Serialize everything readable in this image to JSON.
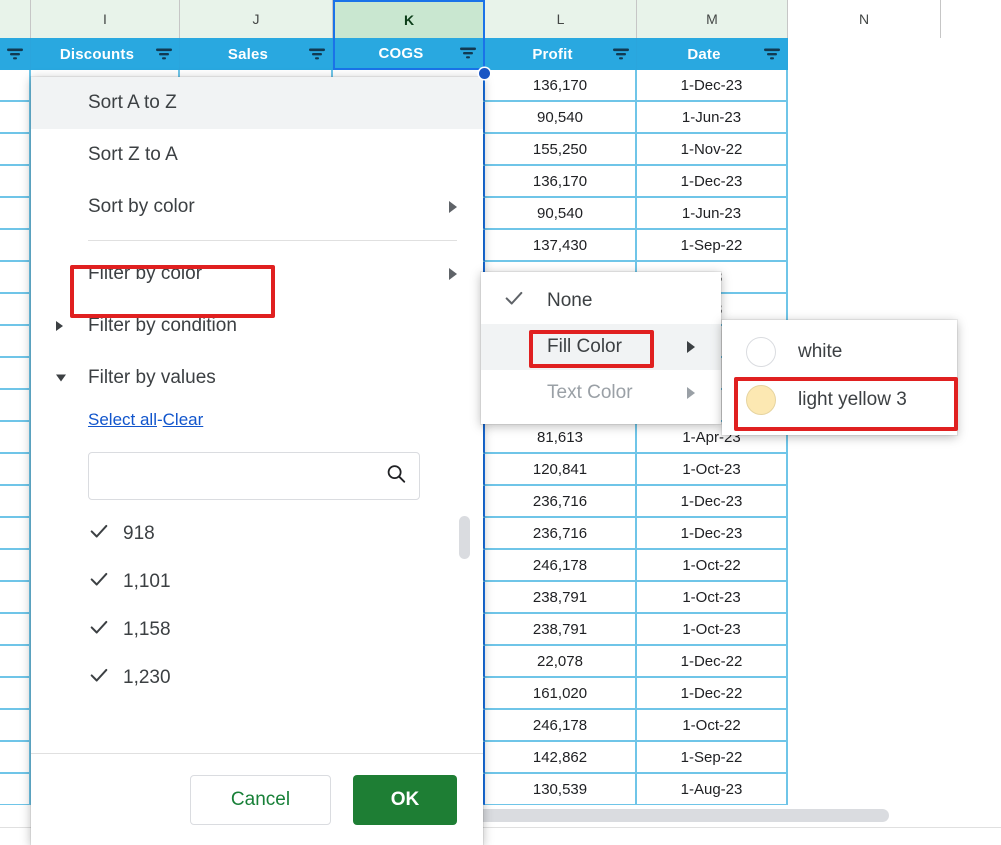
{
  "sheet": {
    "column_letters": [
      "I",
      "J",
      "K",
      "L",
      "M",
      "N"
    ],
    "selected_column": "K",
    "filter_headers": [
      "Discounts",
      "Sales",
      "COGS",
      "Profit",
      "Date"
    ],
    "header_bg": "#29a8e0",
    "header_text_color": "#ffffff",
    "gridline_color": "#6fc5e8",
    "selection_color": "#1a73e8",
    "column_head_bg": "#e8f3ea",
    "column_head_selected_bg": "#c9e7d0",
    "rows": [
      {
        "profit": "136,170",
        "date": "1-Dec-23"
      },
      {
        "profit": "90,540",
        "date": "1-Jun-23"
      },
      {
        "profit": "155,250",
        "date": "1-Nov-22"
      },
      {
        "profit": "136,170",
        "date": "1-Dec-23"
      },
      {
        "profit": "90,540",
        "date": "1-Jun-23"
      },
      {
        "profit": "137,430",
        "date": "1-Sep-22"
      },
      {
        "profit": "",
        "date": "-23"
      },
      {
        "profit": "",
        "date": "-23"
      },
      {
        "profit": "",
        "date": ""
      },
      {
        "profit": "",
        "date": ""
      },
      {
        "profit": "",
        "date": ""
      },
      {
        "profit": "81,613",
        "date": "1-Apr-23"
      },
      {
        "profit": "120,841",
        "date": "1-Oct-23"
      },
      {
        "profit": "236,716",
        "date": "1-Dec-23"
      },
      {
        "profit": "236,716",
        "date": "1-Dec-23"
      },
      {
        "profit": "246,178",
        "date": "1-Oct-22"
      },
      {
        "profit": "238,791",
        "date": "1-Oct-23"
      },
      {
        "profit": "238,791",
        "date": "1-Oct-23"
      },
      {
        "profit": "22,078",
        "date": "1-Dec-22"
      },
      {
        "profit": "161,020",
        "date": "1-Dec-22"
      },
      {
        "profit": "246,178",
        "date": "1-Oct-22"
      },
      {
        "profit": "142,862",
        "date": "1-Sep-22"
      },
      {
        "profit": "130,539",
        "date": "1-Aug-23"
      }
    ]
  },
  "filter_menu": {
    "items": [
      {
        "label": "Sort A to Z",
        "highlighted": true,
        "arrow": "none",
        "leading": "none"
      },
      {
        "label": "Sort Z to A",
        "highlighted": false,
        "arrow": "none",
        "leading": "none"
      },
      {
        "label": "Sort by color",
        "highlighted": false,
        "arrow": "right",
        "leading": "none"
      },
      {
        "label": "Filter by color",
        "highlighted": false,
        "arrow": "right",
        "leading": "none"
      },
      {
        "label": "Filter by condition",
        "highlighted": false,
        "arrow": "none",
        "leading": "right"
      },
      {
        "label": "Filter by values",
        "highlighted": false,
        "arrow": "none",
        "leading": "down"
      }
    ],
    "select_all_label": "Select all",
    "separator": "-",
    "clear_label": "Clear",
    "search": {
      "value": "",
      "placeholder": ""
    },
    "values": [
      "918",
      "1,101",
      "1,158",
      "1,230"
    ],
    "cancel_label": "Cancel",
    "ok_label": "OK",
    "ok_color": "#1e7e34",
    "cancel_text_color": "#188038"
  },
  "color_submenu": {
    "items": [
      {
        "label": "None",
        "checked": true,
        "arrow": false,
        "disabled": false,
        "highlighted": false
      },
      {
        "label": "Fill Color",
        "checked": false,
        "arrow": true,
        "disabled": false,
        "highlighted": true
      },
      {
        "label": "Text Color",
        "checked": false,
        "arrow": true,
        "disabled": true,
        "highlighted": false
      }
    ]
  },
  "swatch_submenu": {
    "items": [
      {
        "label": "white",
        "color": "#ffffff"
      },
      {
        "label": "light yellow 3",
        "color": "#fce8b2"
      }
    ]
  },
  "annotations": {
    "highlight_color": "#e02020",
    "boxes": [
      "filter-by-color",
      "fill-color",
      "light-yellow-3"
    ]
  }
}
